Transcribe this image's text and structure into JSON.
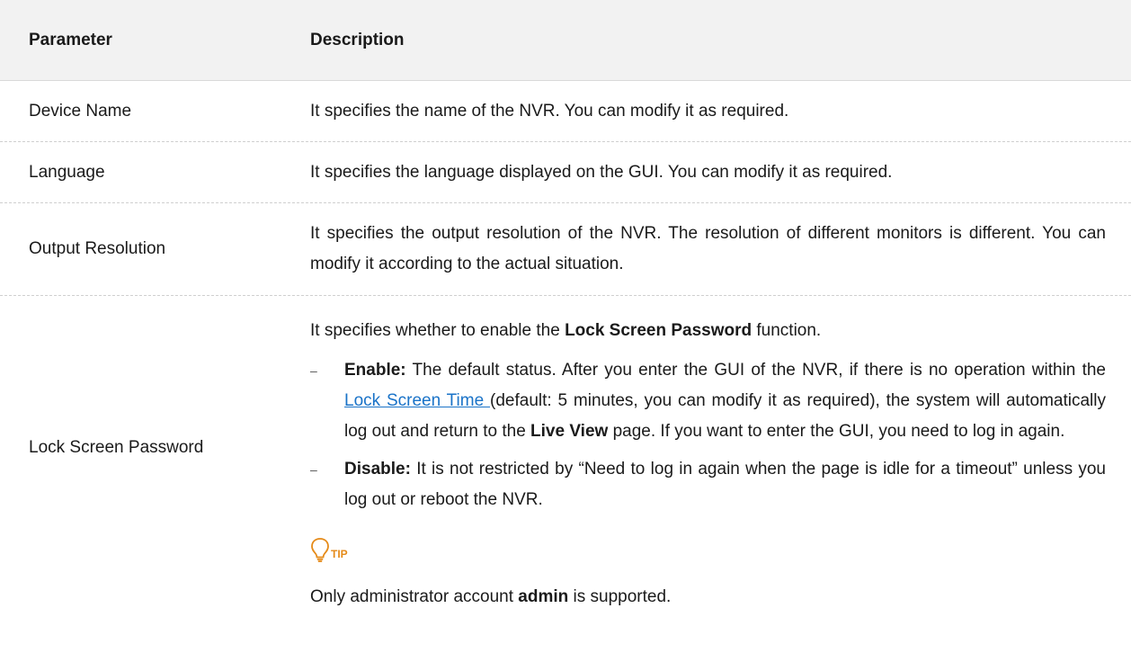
{
  "header": {
    "parameter": "Parameter",
    "description": "Description"
  },
  "rows": [
    {
      "parameter": "Device Name",
      "description": "It specifies the name of the NVR. You can modify it as required."
    },
    {
      "parameter": "Language",
      "description": "It specifies the language displayed on the GUI. You can modify it as required."
    },
    {
      "parameter": "Output Resolution",
      "description": "It specifies the output resolution of the NVR. The resolution of different monitors is different. You can modify it according to the actual situation."
    }
  ],
  "lock": {
    "parameter": "Lock Screen Password",
    "intro_prefix": "It specifies whether to enable the ",
    "intro_bold": "Lock Screen Password",
    "intro_suffix": " function.",
    "dash": "–",
    "enable_label": "Enable:",
    "enable_text_1": " The default status. After you enter the GUI of the NVR, if there is no operation within the ",
    "enable_link": "Lock Screen Time ",
    "enable_text_2": "(default: 5 minutes, you can modify it as required), the system will automatically log out and return to the ",
    "enable_bold_2": "Live View",
    "enable_text_3": " page. If you want to enter the GUI, you need to log in again.",
    "disable_label": "Disable:",
    "disable_text": " It is not restricted by “Need to log in again when the page is idle for a timeout” unless you log out or reboot the NVR.",
    "tip_label": "TIP",
    "tip_prefix": "Only administrator account ",
    "tip_bold": "admin",
    "tip_suffix": " is supported."
  },
  "colors": {
    "header_bg": "#f2f2f2",
    "link": "#1a73c8",
    "tip": "#e58a18"
  },
  "icons": {
    "tip": "lightbulb-icon"
  }
}
